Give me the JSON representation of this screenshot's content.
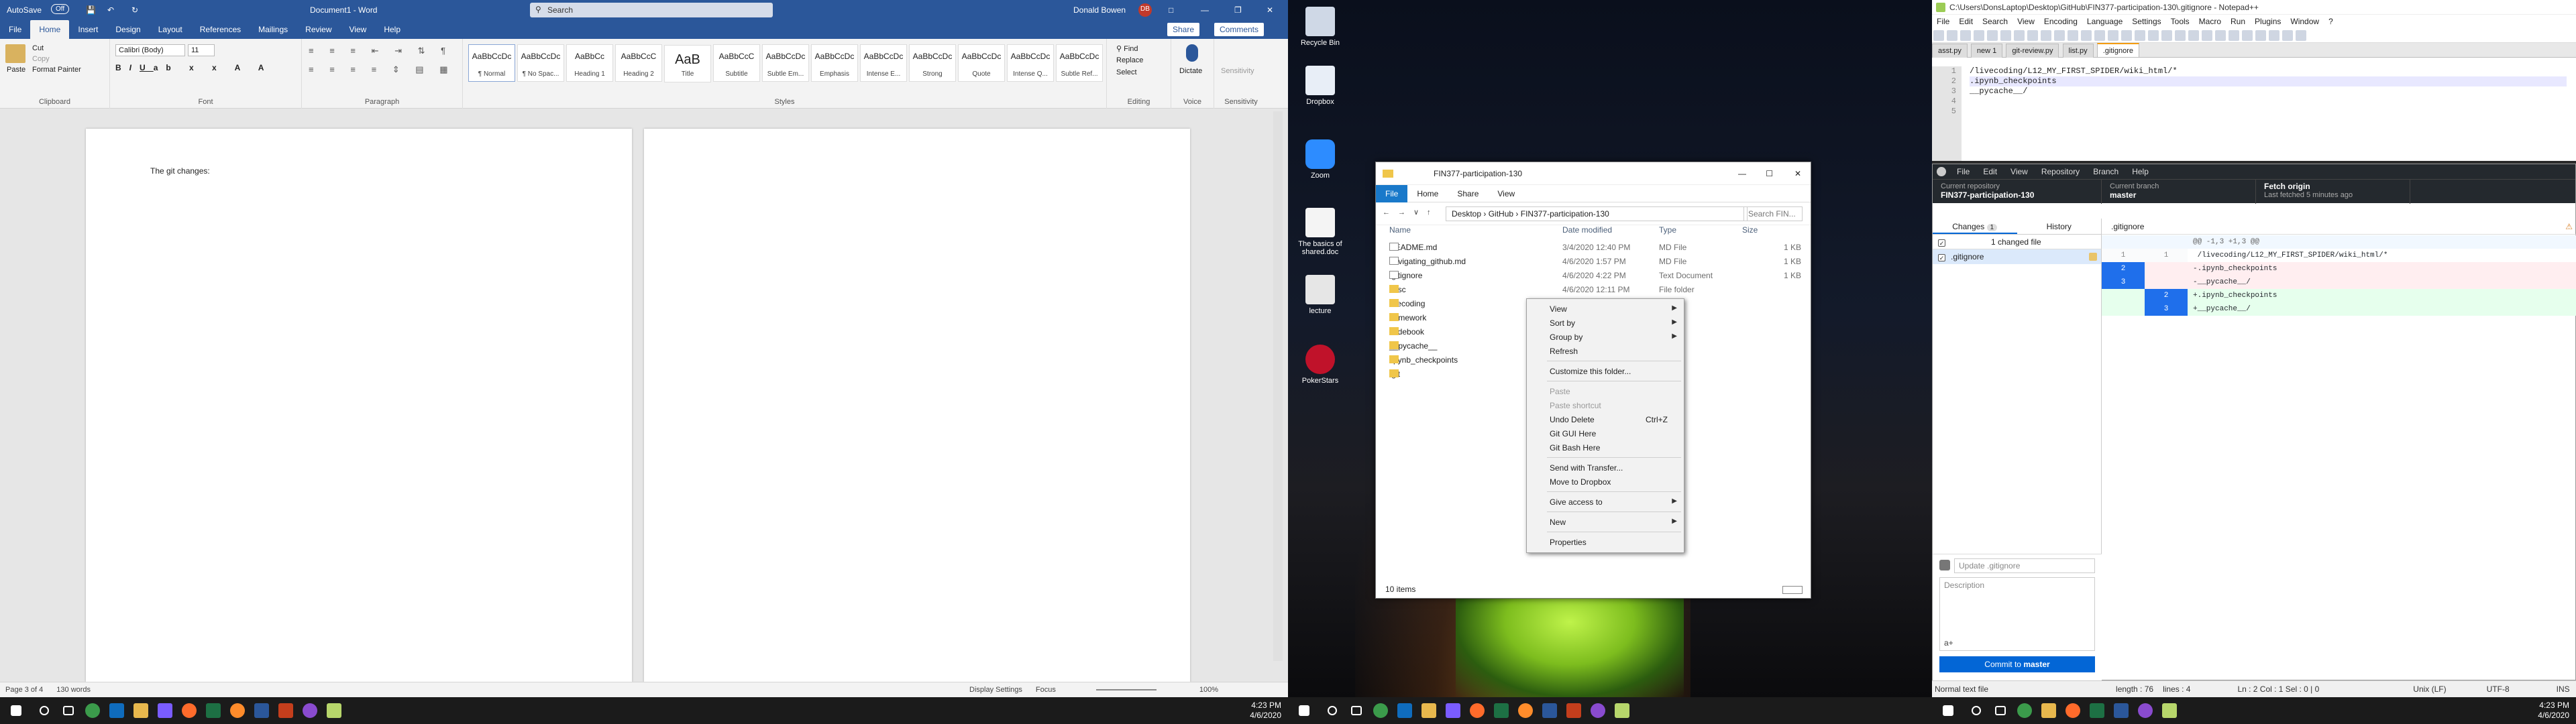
{
  "word": {
    "autosave": "AutoSave",
    "autosave_state": "Off",
    "doc_title": "Document1 - Word",
    "search_placeholder": "Search",
    "user": "Donald Bowen",
    "user_initials": "DB",
    "menu": [
      "File",
      "Home",
      "Insert",
      "Design",
      "Layout",
      "References",
      "Mailings",
      "Review",
      "View",
      "Help"
    ],
    "share": "Share",
    "comments": "Comments",
    "clipboard": {
      "paste": "Paste",
      "cut": "Cut",
      "copy": "Copy",
      "format_painter": "Format Painter",
      "label": "Clipboard"
    },
    "font": {
      "name": "Calibri (Body)",
      "size": "11",
      "label": "Font"
    },
    "paragraph_label": "Paragraph",
    "styles": [
      {
        "prev": "AaBbCcDc",
        "name": "¶ Normal"
      },
      {
        "prev": "AaBbCcDc",
        "name": "¶ No Spac..."
      },
      {
        "prev": "AaBbCc",
        "name": "Heading 1"
      },
      {
        "prev": "AaBbCcC",
        "name": "Heading 2"
      },
      {
        "prev": "AaB",
        "name": "Title"
      },
      {
        "prev": "AaBbCcC",
        "name": "Subtitle"
      },
      {
        "prev": "AaBbCcDc",
        "name": "Subtle Em..."
      },
      {
        "prev": "AaBbCcDc",
        "name": "Emphasis"
      },
      {
        "prev": "AaBbCcDc",
        "name": "Intense E..."
      },
      {
        "prev": "AaBbCcDc",
        "name": "Strong"
      },
      {
        "prev": "AaBbCcDc",
        "name": "Quote"
      },
      {
        "prev": "AaBbCcDc",
        "name": "Intense Q..."
      },
      {
        "prev": "AaBbCcDc",
        "name": "Subtle Ref..."
      }
    ],
    "styles_label": "Styles",
    "editing": {
      "find": "Find",
      "replace": "Replace",
      "select": "Select",
      "label": "Editing"
    },
    "voice": {
      "dictate": "Dictate",
      "label": "Voice"
    },
    "sensitivity": {
      "btn": "Sensitivity",
      "label": "Sensitivity"
    },
    "page_text": "The git changes:",
    "status": {
      "page": "Page 3 of 4",
      "words": "130 words",
      "display": "Display Settings",
      "focus": "Focus",
      "zoom": "100%"
    }
  },
  "taskbar": {
    "time": "4:23 PM",
    "date": "4/6/2020"
  },
  "desktop": {
    "icons": [
      "Recycle Bin",
      "Dropbox",
      "Zoom",
      "The basics of shared.doc",
      "lecture",
      "PokerStars"
    ]
  },
  "explorer": {
    "title": "FIN377-participation-130",
    "tabs": [
      "File",
      "Home",
      "Share",
      "View"
    ],
    "path": [
      "Desktop",
      "GitHub",
      "FIN377-participation-130"
    ],
    "search_placeholder": "Search FIN...",
    "columns": [
      "Name",
      "Date modified",
      "Type",
      "Size"
    ],
    "files": [
      {
        "name": "README.md",
        "date": "3/4/2020 12:40 PM",
        "type": "MD File",
        "size": "1 KB",
        "kind": "doc"
      },
      {
        "name": "navigating_github.md",
        "date": "4/6/2020 1:57 PM",
        "type": "MD File",
        "size": "1 KB",
        "kind": "doc"
      },
      {
        "name": ".gitignore",
        "date": "4/6/2020 4:22 PM",
        "type": "Text Document",
        "size": "1 KB",
        "kind": "doc"
      },
      {
        "name": "misc",
        "date": "4/6/2020 12:11 PM",
        "type": "File folder",
        "size": "",
        "kind": "folder"
      },
      {
        "name": "livecoding",
        "date": "",
        "type": "lder",
        "size": "",
        "kind": "folder"
      },
      {
        "name": "homework",
        "date": "",
        "type": "lder",
        "size": "",
        "kind": "folder"
      },
      {
        "name": "codebook",
        "date": "",
        "type": "lder",
        "size": "",
        "kind": "folder"
      },
      {
        "name": "__pycache__",
        "date": "",
        "type": "lder",
        "size": "",
        "kind": "folder"
      },
      {
        "name": ".ipynb_checkpoints",
        "date": "",
        "type": "lder",
        "size": "",
        "kind": "folder"
      },
      {
        "name": ".git",
        "date": "",
        "type": "lder",
        "size": "",
        "kind": "folder"
      }
    ],
    "count": "10 items"
  },
  "context_menu": {
    "items": [
      {
        "label": "View",
        "sub": true
      },
      {
        "label": "Sort by",
        "sub": true
      },
      {
        "label": "Group by",
        "sub": true
      },
      {
        "label": "Refresh"
      },
      {
        "sep": true
      },
      {
        "label": "Customize this folder..."
      },
      {
        "sep": true
      },
      {
        "label": "Paste",
        "disabled": true
      },
      {
        "label": "Paste shortcut",
        "disabled": true
      },
      {
        "label": "Undo Delete",
        "shortcut": "Ctrl+Z"
      },
      {
        "label": "Git GUI Here"
      },
      {
        "label": "Git Bash Here"
      },
      {
        "sep": true
      },
      {
        "label": "Send with Transfer..."
      },
      {
        "label": "Move to Dropbox"
      },
      {
        "sep": true
      },
      {
        "label": "Give access to",
        "sub": true
      },
      {
        "sep": true
      },
      {
        "label": "New",
        "sub": true
      },
      {
        "sep": true
      },
      {
        "label": "Properties"
      }
    ]
  },
  "notepad": {
    "title": "C:\\Users\\DonsLaptop\\Desktop\\GitHub\\FIN377-participation-130\\.gitignore - Notepad++",
    "menu": [
      "File",
      "Edit",
      "Search",
      "View",
      "Encoding",
      "Language",
      "Settings",
      "Tools",
      "Macro",
      "Run",
      "Plugins",
      "Window",
      "?"
    ],
    "tabs": [
      "asst.py",
      "new 1",
      "git-review.py",
      "list.py",
      ".gitignore"
    ],
    "lines": [
      "/livecoding/L12_MY_FIRST_SPIDER/wiki_html/*",
      ".ipynb_checkpoints",
      "__pycache__/",
      "",
      ""
    ],
    "status": {
      "type": "Normal text file",
      "length": "length : 76",
      "lines": "lines : 4",
      "pos": "Ln : 2    Col : 1    Sel : 0 | 0",
      "eol": "Unix (LF)",
      "enc": "UTF-8",
      "ins": "INS"
    }
  },
  "github": {
    "menu": [
      "File",
      "Edit",
      "View",
      "Repository",
      "Branch",
      "Help"
    ],
    "repo_label": "Current repository",
    "repo": "FIN377-participation-130",
    "branch_label": "Current branch",
    "branch": "master",
    "fetch": "Fetch origin",
    "fetch_sub": "Last fetched 5 minutes ago",
    "tabs": [
      "Changes",
      "History"
    ],
    "changes_count": "1",
    "changed_files": "1 changed file",
    "file": ".gitignore",
    "diff_file": ".gitignore",
    "diff": [
      {
        "old": "",
        "new": "",
        "text": "@@ -1,3 +1,3 @@",
        "kind": "hunk"
      },
      {
        "old": "1",
        "new": "1",
        "text": " /livecoding/L12_MY_FIRST_SPIDER/wiki_html/*",
        "kind": "ctx"
      },
      {
        "old": "2",
        "new": "",
        "text": "-.ipynb_checkpoints",
        "kind": "del"
      },
      {
        "old": "3",
        "new": "",
        "text": "-__pycache__/",
        "kind": "del"
      },
      {
        "old": "",
        "new": "2",
        "text": "+.ipynb_checkpoints",
        "kind": "add"
      },
      {
        "old": "",
        "new": "3",
        "text": "+__pycache__/",
        "kind": "add"
      }
    ],
    "summary_placeholder": "Update .gitignore",
    "desc_placeholder": "Description",
    "coauthor": "a+",
    "commit": "Commit to",
    "commit_branch": "master"
  }
}
